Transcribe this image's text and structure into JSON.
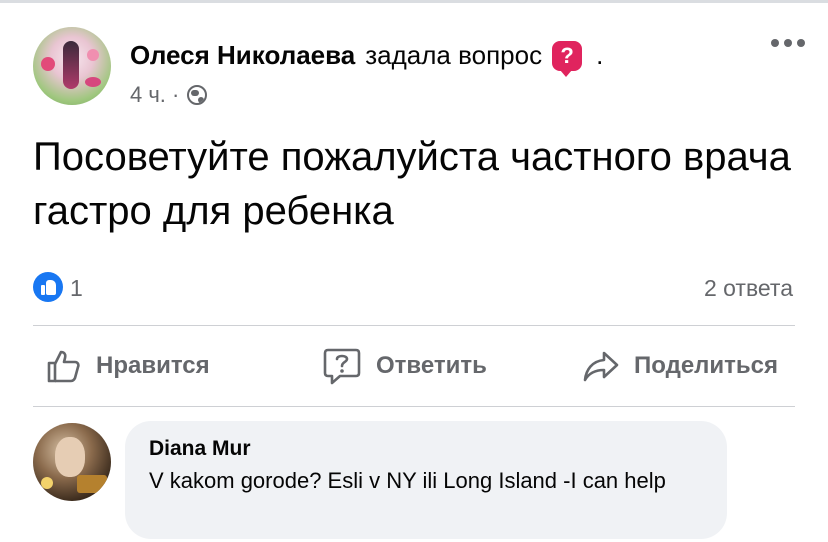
{
  "post": {
    "author": "Олеся Николаева",
    "action": "задала вопрос",
    "action_badge": "?",
    "trailing_dot": ".",
    "time": "4 ч. ·",
    "question": "Посоветуйте пожалуйста частного врача гастро для ребенка",
    "reaction_count": "1",
    "answers": "2 ответа"
  },
  "actions": {
    "like": "Нравится",
    "reply": "Ответить",
    "share": "Поделиться"
  },
  "comment": {
    "author": "Diana Mur",
    "text": "V kakom gorode? Esli v NY ili Long Island -I can help"
  },
  "icons": {
    "author_avatar": "avatar-photo",
    "question_badge": "question-icon",
    "privacy": "globe-icon",
    "more": "more-options-icon",
    "reaction": "like-reaction-icon",
    "like_action": "thumbs-up-icon",
    "reply_action": "question-bubble-icon",
    "share_action": "share-arrow-icon",
    "commenter_avatar": "avatar-photo"
  },
  "colors": {
    "accent": "#1877f2",
    "badge": "#e0245e",
    "muted_text": "#65676b",
    "bubble_bg": "#f0f2f5"
  }
}
